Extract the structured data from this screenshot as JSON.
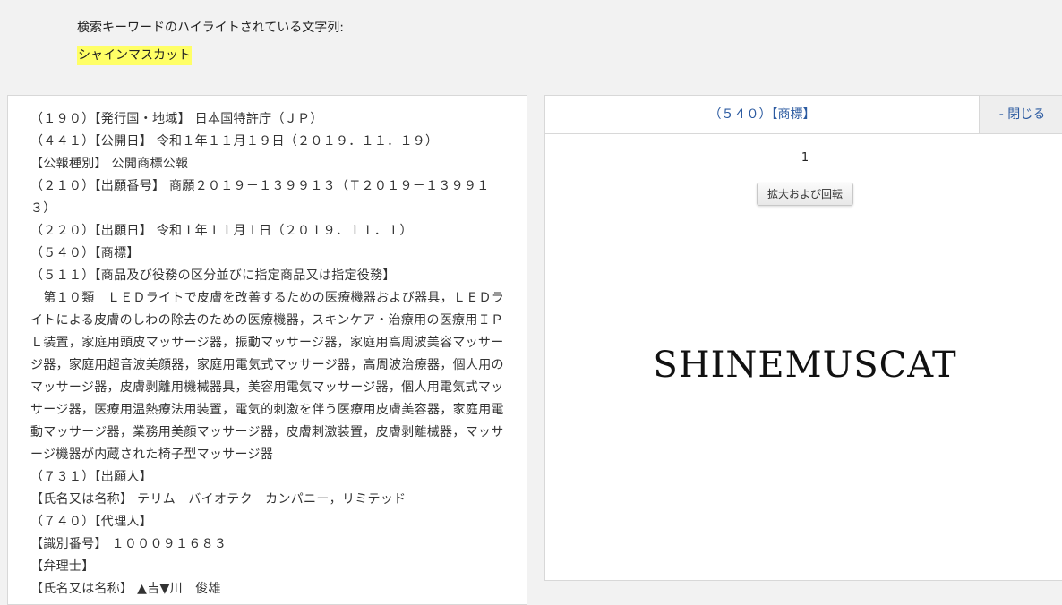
{
  "search": {
    "caption": "検索キーワードのハイライトされている文字列:",
    "highlighted": "シャインマスカット"
  },
  "record": {
    "lines": [
      "（１９０）【発行国・地域】 日本国特許庁（ＪＰ）",
      "（４４１）【公開日】 令和１年１１月１９日（２０１９．１１．１９）",
      "【公報種別】 公開商標公報",
      "（２１０）【出願番号】 商願２０１９－１３９９１３（Ｔ２０１９－１３９９１３）",
      "（２２０）【出願日】 令和１年１１月１日（２０１９．１１．１）",
      "（５４０）【商標】",
      "（５１１）【商品及び役務の区分並びに指定商品又は指定役務】",
      "　第１０類　ＬＥＤライトで皮膚を改善するための医療機器および器具，ＬＥＤライトによる皮膚のしわの除去のための医療機器，スキンケア・治療用の医療用ＩＰＬ装置，家庭用頭皮マッサージ器，振動マッサージ器，家庭用高周波美容マッサージ器，家庭用超音波美顔器，家庭用電気式マッサージ器，高周波治療器，個人用のマッサージ器，皮膚剥離用機械器具，美容用電気マッサージ器，個人用電気式マッサージ器，医療用温熱療法用装置，電気的刺激を伴う医療用皮膚美容器，家庭用電動マッサージ器，業務用美顔マッサージ器，皮膚刺激装置，皮膚剥離械器，マッサージ機器が内蔵された椅子型マッサージ器",
      "（７３１）【出願人】",
      "【氏名又は名称】 テリム　バイオテク　カンパニー，リミテッド",
      "（７４０）【代理人】",
      "【識別番号】 １０００９１６８３",
      "【弁理士】",
      "【氏名又は名称】 ▲吉▼川　俊雄"
    ]
  },
  "viewer": {
    "tab_title": "（５４０）【商標】",
    "close_label": "- 閉じる",
    "page_number": "1",
    "zoom_button": "拡大および回転",
    "mark_text": "SHINEMUSCAT"
  },
  "colors": {
    "highlight": "#ffff66",
    "link": "#2b5aa0"
  }
}
